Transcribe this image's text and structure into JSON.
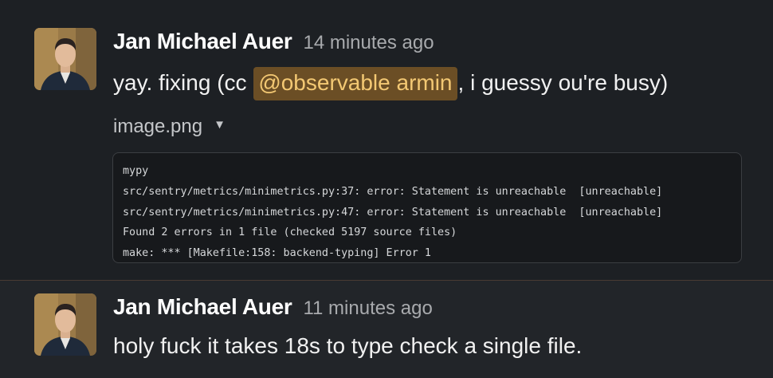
{
  "messages": [
    {
      "author": "Jan Michael Auer",
      "timestamp": "14 minutes ago",
      "text_before": "yay. fixing (cc ",
      "mention": "@observable armin",
      "text_after": ", i guessy ou're busy)",
      "attachment": {
        "filename": "image.png",
        "caret_icon": "▼",
        "code_lines": [
          "mypy",
          "src/sentry/metrics/minimetrics.py:37: error: Statement is unreachable  [unreachable]",
          "src/sentry/metrics/minimetrics.py:47: error: Statement is unreachable  [unreachable]",
          "Found 2 errors in 1 file (checked 5197 source files)",
          "make: *** [Makefile:158: backend-typing] Error 1"
        ]
      }
    },
    {
      "author": "Jan Michael Auer",
      "timestamp": "11 minutes ago",
      "text": "holy fuck it takes 18s to type check a single file."
    }
  ],
  "colors": {
    "background": "#1a1d21",
    "mention_bg": "#6b4e25",
    "mention_text": "#f3c873",
    "divider": "#4a3b32"
  }
}
